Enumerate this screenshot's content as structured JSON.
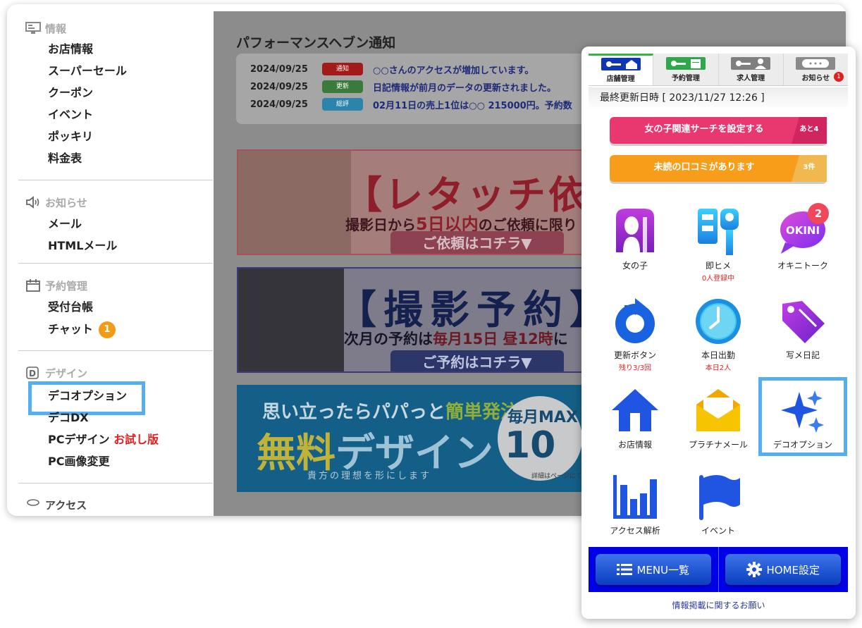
{
  "colors": {
    "accent_highlight": "#55aef0",
    "badge_orange": "#f39a16",
    "tab_active": "#3cb049",
    "bottom_bar": "#0000e6",
    "link_blue": "#2b3b9a"
  },
  "sidebar": {
    "sections": [
      {
        "title": "情報",
        "icon": "monitor-icon",
        "items": [
          "お店情報",
          "スーパーセール",
          "クーポン",
          "イベント",
          "ポッキリ",
          "料金表"
        ]
      },
      {
        "title": "お知らせ",
        "icon": "speaker-icon",
        "items": [
          "メール",
          "HTMLメール"
        ]
      },
      {
        "title": "予約管理",
        "icon": "calendar-icon",
        "items": [
          "受付台帳",
          "チャット"
        ],
        "chat_badge": "1"
      },
      {
        "title": "デザイン",
        "icon": "design-d-icon",
        "items": [
          "デコオプション",
          "デコDX",
          "PCデザイン",
          "PC画像変更"
        ],
        "pc_design_trial": "お試し版"
      },
      {
        "title": "アクセス",
        "icon": "database-icon",
        "items": []
      }
    ]
  },
  "main": {
    "notification_title": "パフォーマンスヘブン通知",
    "notifications": [
      {
        "date": "2024/09/25",
        "tag": "通知",
        "tag_color": "#c41a1a",
        "message": "○○さんのアクセスが増加しています。"
      },
      {
        "date": "2024/09/25",
        "tag": "更新",
        "tag_color": "#3d9a3d",
        "message": "日記情報が前月のデータの更新されました。"
      },
      {
        "date": "2024/09/25",
        "tag": "総評",
        "tag_color": "#2aa6d6",
        "message": "02月11日の売上1位は○○ 215000円。予約数"
      }
    ],
    "banners": {
      "retouch": {
        "headline": "【レタッチ依頼",
        "sub_before": "撮影日から",
        "sub_strong": "5日以内",
        "sub_after": "のご依頼に限り",
        "button": "ご依頼はコチラ▼"
      },
      "photo": {
        "headline": "【撮影予約】",
        "sub_before": "次月の予約は",
        "sub_strong1": "毎月15日",
        "sub_mid": " ",
        "sub_strong2": "昼12時",
        "sub_after": "に",
        "button": "ご予約はコチラ▼"
      },
      "design": {
        "line1_before": "思い立ったらパパっと",
        "line1_strong": "簡単発注",
        "line2_strong": "無料",
        "line2_rest": "デザイン",
        "line3": "貴方の理想を形にします",
        "circle_top": "毎月MAX",
        "circle_big": "10",
        "circle_small": "詳細はページにて"
      }
    }
  },
  "mobile": {
    "tabs": [
      {
        "label": "店舗管理",
        "icon": "key-house-icon",
        "active": true
      },
      {
        "label": "予約管理",
        "icon": "key-calendar-icon",
        "active": false
      },
      {
        "label": "求人管理",
        "icon": "key-person-icon",
        "active": false
      },
      {
        "label": "お知らせ",
        "icon": "speech-bubble-icon",
        "active": false,
        "badge": "1"
      }
    ],
    "last_updated_label": "最終更新日時",
    "last_updated_value": "[ 2023/11/27 12:26 ]",
    "pills": [
      {
        "label": "女の子関連サーチを設定する",
        "count": "あと4"
      },
      {
        "label": "未読の口コミがあります",
        "count": "3件"
      }
    ],
    "tiles": [
      {
        "label": "女の子",
        "sub": "",
        "icon": "girl-silhouette-icon"
      },
      {
        "label": "即ヒメ",
        "sub": "0人登録中",
        "icon": "sokuhime-icon"
      },
      {
        "label": "オキニトーク",
        "sub": "",
        "icon": "okini-chat-icon",
        "badge": "2",
        "logo_text": "OKINI"
      },
      {
        "label": "更新ボタン",
        "sub": "残り3/3回",
        "icon": "refresh-icon"
      },
      {
        "label": "本日出勤",
        "sub": "本日2人",
        "icon": "clock-icon"
      },
      {
        "label": "写メ日記",
        "sub": "",
        "icon": "tag-icon"
      },
      {
        "label": "お店情報",
        "sub": "",
        "icon": "house-icon"
      },
      {
        "label": "プラチナメール",
        "sub": "",
        "icon": "envelope-icon"
      },
      {
        "label": "デコオプション",
        "sub": "",
        "icon": "sparkle-icon"
      },
      {
        "label": "アクセス解析",
        "sub": "",
        "icon": "bar-chart-icon"
      },
      {
        "label": "イベント",
        "sub": "",
        "icon": "flag-icon"
      }
    ],
    "bottom_buttons": [
      {
        "label": "MENU一覧",
        "icon": "list-icon"
      },
      {
        "label": "HOME設定",
        "icon": "gear-icon"
      }
    ],
    "footer_link": "情報掲載に関するお願い"
  }
}
